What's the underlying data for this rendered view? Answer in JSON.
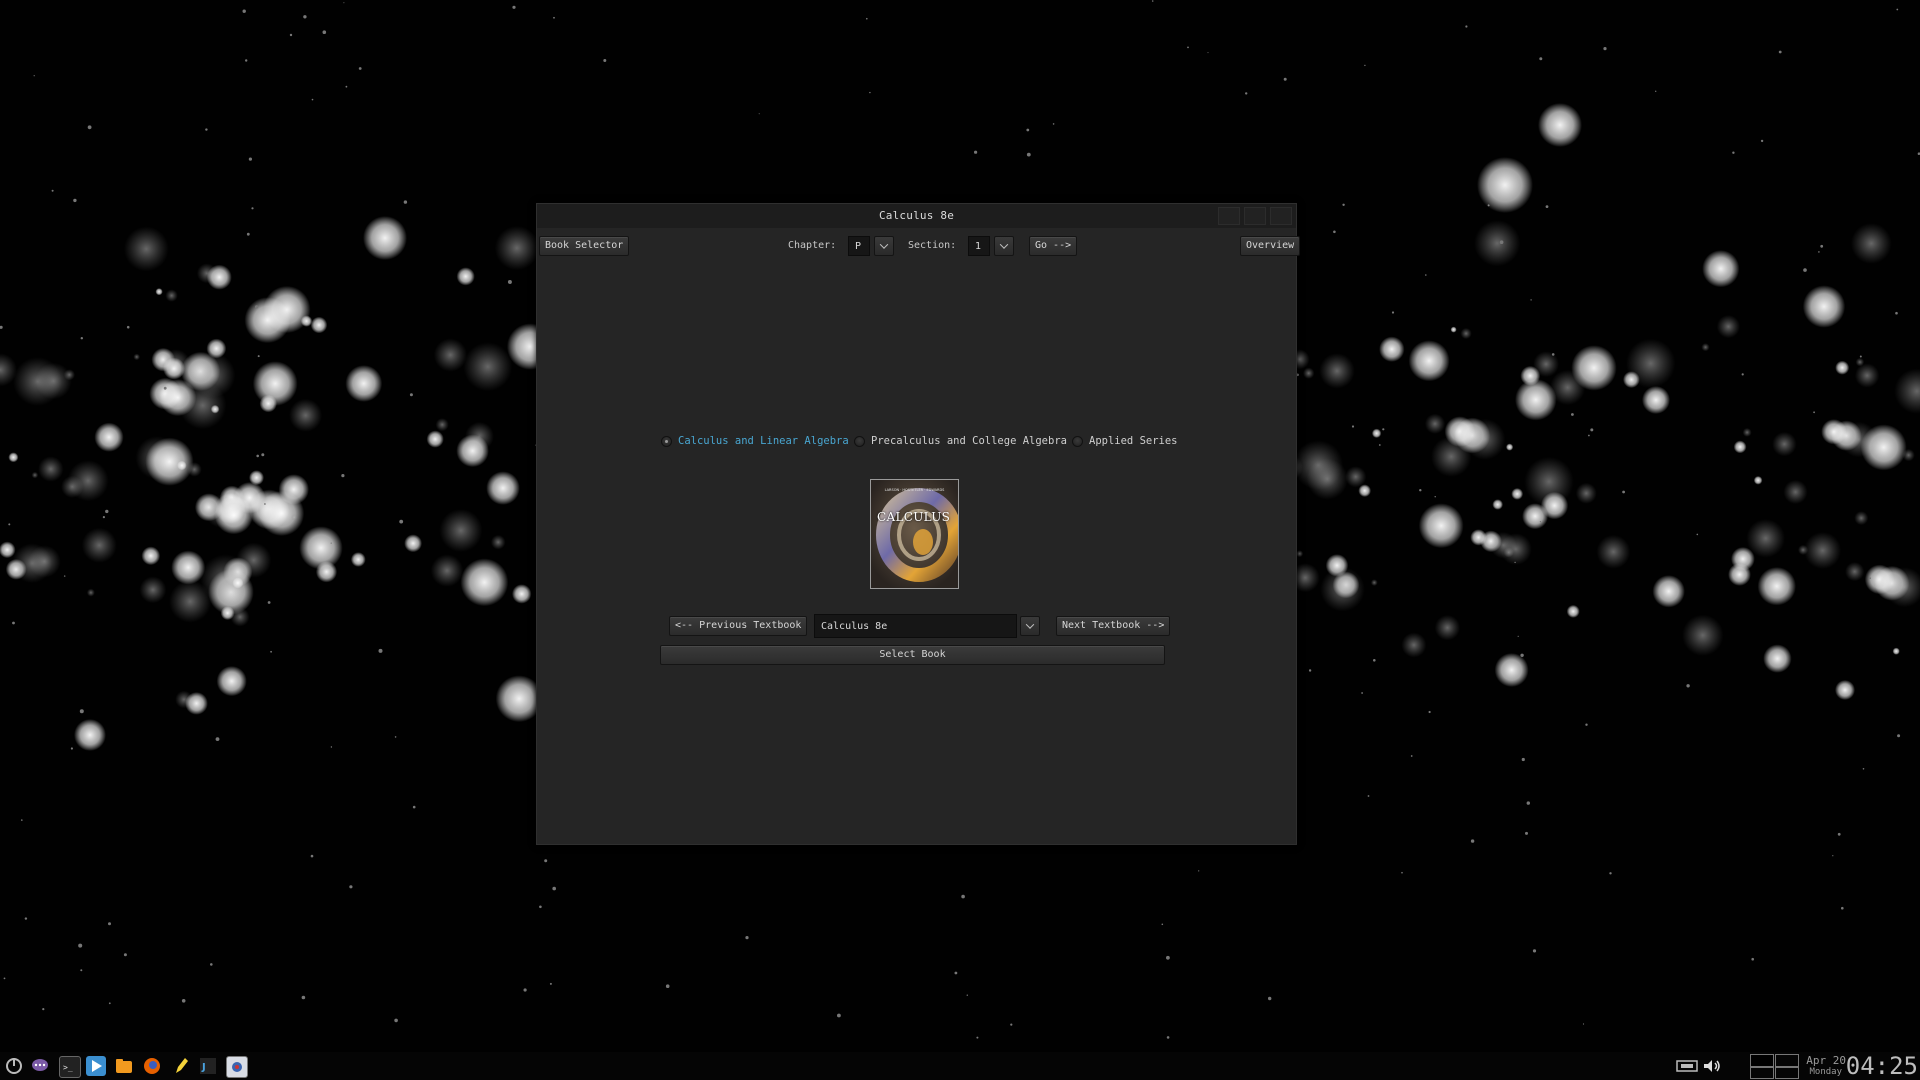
{
  "window": {
    "title": "Calculus 8e"
  },
  "toolbar": {
    "book_selector_label": "Book Selector",
    "chapter_label": "Chapter:",
    "chapter_value": "P",
    "section_label": "Section:",
    "section_value": "1",
    "go_label": "Go -->",
    "overview_label": "Overview"
  },
  "series": {
    "options": [
      {
        "label": "Calculus and Linear Algebra",
        "checked": true
      },
      {
        "label": "Precalculus and College Algebra",
        "checked": false
      },
      {
        "label": "Applied Series",
        "checked": false
      }
    ]
  },
  "cover": {
    "title": "CALCULUS",
    "authors": "LARSON · HOSTETLER · EDWARDS"
  },
  "navigation": {
    "previous_label": "<-- Previous Textbook",
    "book_value": "Calculus 8e",
    "next_label": "Next Textbook -->",
    "select_label": "Select Book"
  },
  "taskbar": {
    "icons": [
      "power-icon",
      "chat-icon",
      "terminal-icon",
      "media-player-icon",
      "file-manager-icon",
      "firefox-icon",
      "text-editor-icon",
      "ide-icon",
      "app-icon"
    ]
  },
  "clock": {
    "date": "Apr 20",
    "day": "Monday",
    "time": "04:25"
  }
}
